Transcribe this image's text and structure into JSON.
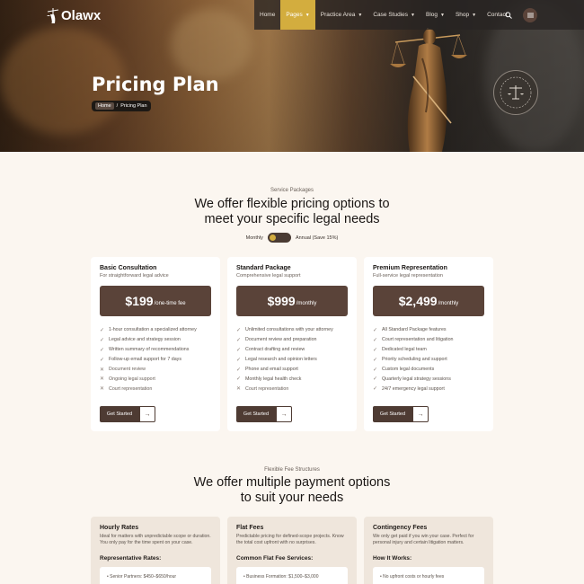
{
  "brand": {
    "name": "Olawx"
  },
  "nav": {
    "items": [
      {
        "label": "Home",
        "caret": false,
        "active": false
      },
      {
        "label": "Pages",
        "caret": true,
        "active": true
      },
      {
        "label": "Practice Area",
        "caret": true,
        "active": false
      },
      {
        "label": "Case Studies",
        "caret": true,
        "active": false
      },
      {
        "label": "Blog",
        "caret": true,
        "active": false
      },
      {
        "label": "Shop",
        "caret": true,
        "active": false
      },
      {
        "label": "Contact",
        "caret": false,
        "active": false
      }
    ],
    "icons": [
      "search-icon",
      "menu-icon"
    ],
    "accent": "#d3ad3e"
  },
  "hero": {
    "title": "Pricing Plan",
    "breadcrumb": {
      "home": "Home",
      "separator": "/",
      "current": "Pricing Plan"
    }
  },
  "pricing": {
    "eyebrow": "Service Packages",
    "title_line1": "We offer flexible pricing options to",
    "title_line2": "meet your specific legal needs",
    "toggle": {
      "monthly": "Monthly",
      "annual": "Annual (Save 15%)"
    },
    "plans": [
      {
        "name": "Basic Consultation",
        "subtitle": "For straightforward legal advice",
        "price": "$199",
        "period": "/one-time fee",
        "features": [
          {
            "text": "1-hour consultation a specialized attorney",
            "included": true
          },
          {
            "text": "Legal advice and strategy session",
            "included": true
          },
          {
            "text": "Written summary of recommendations",
            "included": true
          },
          {
            "text": "Follow-up email support for 7 days",
            "included": true
          },
          {
            "text": "Document review",
            "included": false
          },
          {
            "text": "Ongoing legal support",
            "included": false
          },
          {
            "text": "Court representation",
            "included": false
          }
        ],
        "cta": "Get Started"
      },
      {
        "name": "Standard Package",
        "subtitle": "Comprehensive legal support",
        "price": "$999",
        "period": "/monthly",
        "features": [
          {
            "text": "Unlimited consultations with your attorney",
            "included": true
          },
          {
            "text": "Document review and preparation",
            "included": true
          },
          {
            "text": "Contract drafting and review",
            "included": true
          },
          {
            "text": "Legal research and opinion letters",
            "included": true
          },
          {
            "text": "Phone and email support",
            "included": true
          },
          {
            "text": "Monthly legal health check",
            "included": true
          },
          {
            "text": "Court representation",
            "included": false
          }
        ],
        "cta": "Get Started"
      },
      {
        "name": "Premium Representation",
        "subtitle": "Full-service legal representation",
        "price": "$2,499",
        "period": "/monthly",
        "features": [
          {
            "text": "All Standard Package features",
            "included": true
          },
          {
            "text": "Court representation and litigation",
            "included": true
          },
          {
            "text": "Dedicated legal team",
            "included": true
          },
          {
            "text": "Priority scheduling and support",
            "included": true
          },
          {
            "text": "Custom legal documents",
            "included": true
          },
          {
            "text": "Quarterly legal strategy sessions",
            "included": true
          },
          {
            "text": "24/7 emergency legal support",
            "included": true
          }
        ],
        "cta": "Get Started"
      }
    ]
  },
  "fees": {
    "eyebrow": "Flexible Fee Structures",
    "title_line1": "We offer multiple payment options",
    "title_line2": "to suit your needs",
    "cards": [
      {
        "name": "Hourly Rates",
        "description": "Ideal for matters with unpredictable scope or duration. You only pay for the time spent on your case.",
        "heading": "Representative Rates:",
        "first_item": "Senior Partners: $450–$650/hour"
      },
      {
        "name": "Flat Fees",
        "description": "Predictable pricing for defined-scope projects. Know the total cost upfront with no surprises.",
        "heading": "Common Flat Fee Services:",
        "first_item": "Business Formation: $1,500–$3,000"
      },
      {
        "name": "Contingency Fees",
        "description": "We only get paid if you win your case. Perfect for personal injury and certain litigation matters.",
        "heading": "How It Works:",
        "first_item": "No upfront costs or hourly fees"
      }
    ]
  }
}
